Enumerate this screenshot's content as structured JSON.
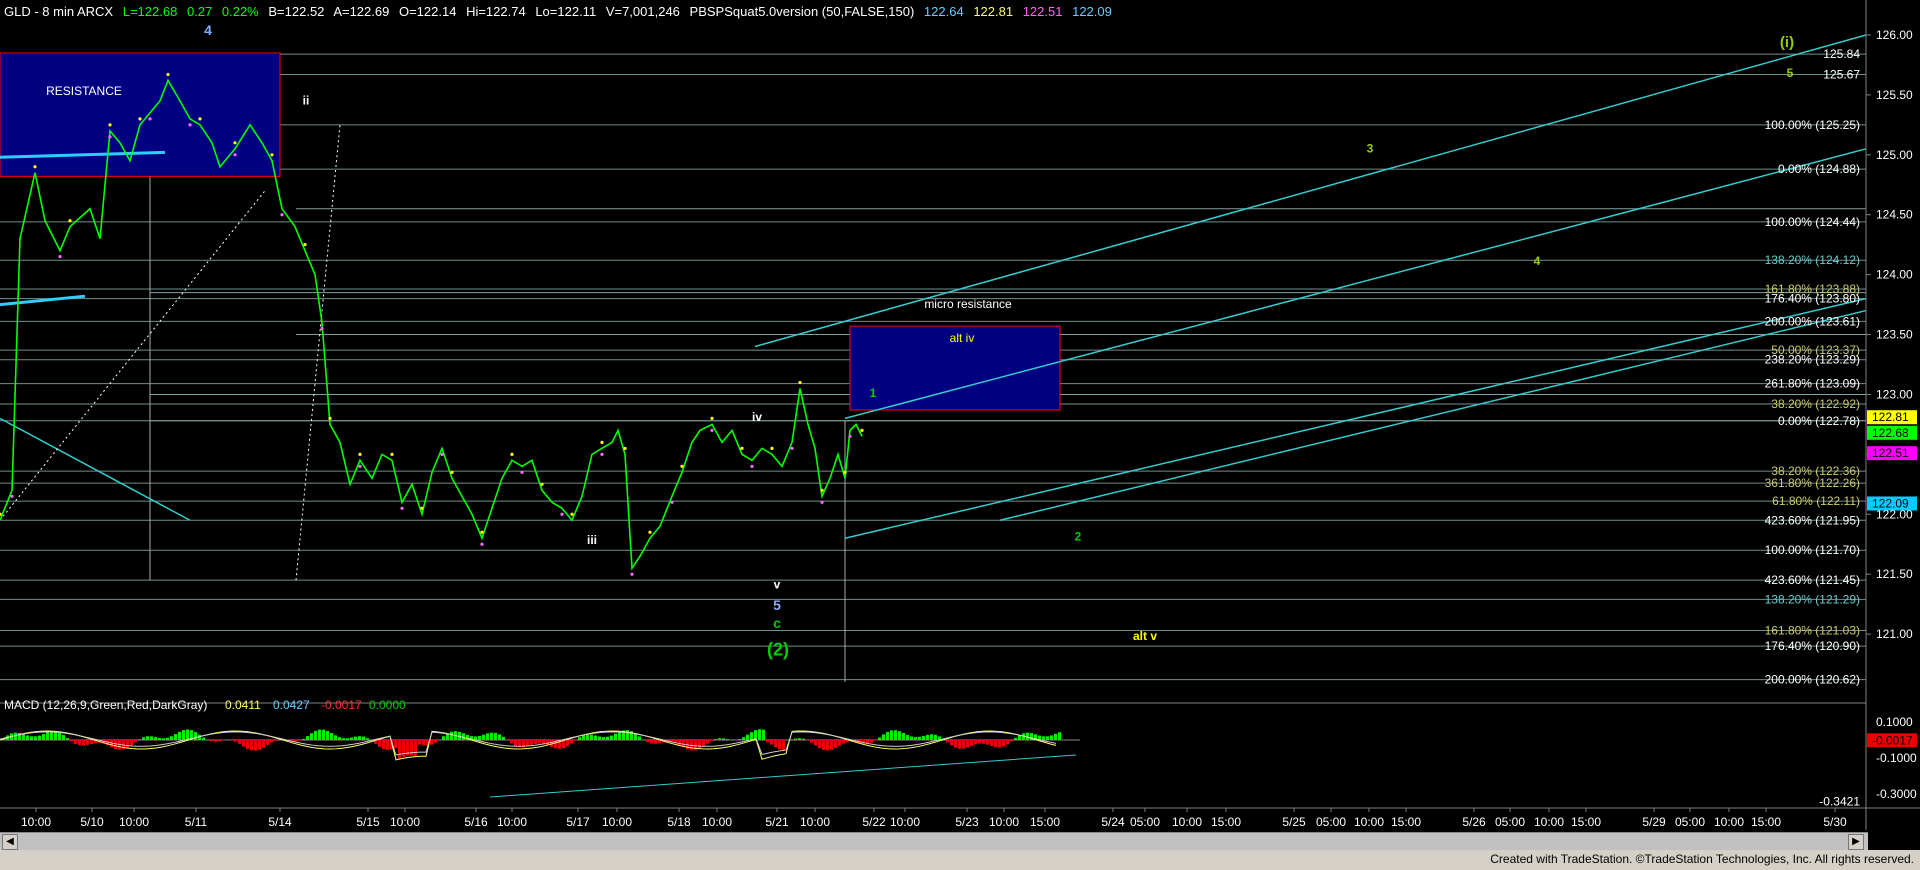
{
  "header": {
    "symbol": "GLD - 8 min  ARCX",
    "last": "L=122.68",
    "change": "0.27",
    "pct": "0.22%",
    "bid": "B=122.52",
    "ask": "A=122.69",
    "open": "O=122.14",
    "hi": "Hi=122.74",
    "lo": "Lo=122.11",
    "vol": "V=7,001,246",
    "study": "PBSPSquat5.0version (50,FALSE,150)",
    "study_values": [
      "122.64",
      "122.81",
      "122.51",
      "122.09"
    ],
    "colors": {
      "symbol": "#ffffff",
      "values": "#00ff00",
      "study": "#ffffff",
      "v1": "#66ccff",
      "v2": "#ffff66",
      "v3": "#ff66ff",
      "v4": "#66ccff"
    }
  },
  "price_axis": {
    "ticks": [
      "126.00",
      "125.50",
      "125.00",
      "124.50",
      "124.00",
      "123.50",
      "123.00",
      "122.50",
      "122.00",
      "121.50",
      "121.00"
    ],
    "ylim": [
      120.45,
      126.15
    ],
    "last_markers": [
      {
        "value": "122.81",
        "color": "#ffff00"
      },
      {
        "value": "122.68",
        "color": "#00ff00"
      },
      {
        "value": "122.51",
        "color": "#ff00ff"
      },
      {
        "value": "122.09",
        "color": "#00ccff"
      }
    ]
  },
  "chart_data": [
    {
      "type": "line",
      "title": "GLD - 8 min",
      "ylim": [
        120.45,
        126.15
      ],
      "x_ticks": [
        "10:00",
        "5/10",
        "10:00",
        "5/11",
        "5/14",
        "5/15",
        "10:00",
        "5/16",
        "10:00",
        "5/17",
        "10:00",
        "5/18",
        "10:00",
        "5/21",
        "10:00",
        "5/22",
        "10:00",
        "5/23",
        "10:00",
        "15:00",
        "5/24",
        "05:00",
        "10:00",
        "15:00",
        "5/25",
        "05:00",
        "10:00",
        "15:00",
        "5/26",
        "05:00",
        "10:00",
        "15:00",
        "5/29",
        "05:00",
        "10:00",
        "15:00",
        "5/30"
      ],
      "price_path": [
        [
          0,
          121.95
        ],
        [
          12,
          122.2
        ],
        [
          20,
          124.3
        ],
        [
          35,
          124.85
        ],
        [
          45,
          124.45
        ],
        [
          60,
          124.2
        ],
        [
          70,
          124.4
        ],
        [
          90,
          124.55
        ],
        [
          100,
          124.3
        ],
        [
          110,
          125.2
        ],
        [
          120,
          125.1
        ],
        [
          130,
          124.95
        ],
        [
          140,
          125.25
        ],
        [
          150,
          125.35
        ],
        [
          160,
          125.45
        ],
        [
          168,
          125.62
        ],
        [
          180,
          125.45
        ],
        [
          190,
          125.3
        ],
        [
          200,
          125.25
        ],
        [
          212,
          125.1
        ],
        [
          220,
          124.9
        ],
        [
          235,
          125.05
        ],
        [
          250,
          125.25
        ],
        [
          262,
          125.1
        ],
        [
          272,
          124.95
        ],
        [
          282,
          124.55
        ],
        [
          295,
          124.4
        ],
        [
          305,
          124.2
        ],
        [
          315,
          124.0
        ],
        [
          322,
          123.6
        ],
        [
          330,
          122.75
        ],
        [
          340,
          122.6
        ],
        [
          350,
          122.25
        ],
        [
          360,
          122.45
        ],
        [
          372,
          122.3
        ],
        [
          382,
          122.5
        ],
        [
          392,
          122.45
        ],
        [
          402,
          122.1
        ],
        [
          412,
          122.25
        ],
        [
          422,
          122.0
        ],
        [
          432,
          122.35
        ],
        [
          442,
          122.55
        ],
        [
          452,
          122.3
        ],
        [
          462,
          122.15
        ],
        [
          472,
          122.0
        ],
        [
          482,
          121.8
        ],
        [
          492,
          122.05
        ],
        [
          502,
          122.3
        ],
        [
          512,
          122.45
        ],
        [
          522,
          122.4
        ],
        [
          532,
          122.45
        ],
        [
          542,
          122.2
        ],
        [
          552,
          122.1
        ],
        [
          562,
          122.05
        ],
        [
          572,
          121.95
        ],
        [
          582,
          122.15
        ],
        [
          592,
          122.5
        ],
        [
          602,
          122.55
        ],
        [
          612,
          122.6
        ],
        [
          618,
          122.7
        ],
        [
          625,
          122.5
        ],
        [
          632,
          121.55
        ],
        [
          640,
          121.65
        ],
        [
          650,
          121.8
        ],
        [
          660,
          121.9
        ],
        [
          672,
          122.15
        ],
        [
          682,
          122.35
        ],
        [
          692,
          122.6
        ],
        [
          700,
          122.7
        ],
        [
          712,
          122.75
        ],
        [
          722,
          122.6
        ],
        [
          732,
          122.7
        ],
        [
          742,
          122.5
        ],
        [
          752,
          122.45
        ],
        [
          762,
          122.55
        ],
        [
          772,
          122.5
        ],
        [
          782,
          122.4
        ],
        [
          792,
          122.6
        ],
        [
          800,
          123.05
        ],
        [
          808,
          122.75
        ],
        [
          815,
          122.55
        ],
        [
          822,
          122.15
        ],
        [
          830,
          122.3
        ],
        [
          838,
          122.5
        ],
        [
          845,
          122.3
        ],
        [
          850,
          122.7
        ],
        [
          856,
          122.75
        ],
        [
          862,
          122.65
        ]
      ]
    },
    {
      "type": "line",
      "title": "MACD (12,26,9,Green,Red,DarkGray)",
      "values_label": [
        "0.0411",
        "0.0427",
        "-0.0017",
        "0.0000"
      ],
      "ticks": [
        "0.1000",
        "-0.1000",
        "-0.3000"
      ],
      "extra_labels": [
        "-0.3421"
      ],
      "last_marker": "-0.0017"
    }
  ],
  "fib_labels": [
    {
      "text": "125.84",
      "color": "#ffffff",
      "price": 125.84
    },
    {
      "text": "125.67",
      "color": "#ffffff",
      "price": 125.67
    },
    {
      "text": "100.00% (125.25)",
      "color": "#ffffff",
      "price": 125.25
    },
    {
      "text": "0.00% (124.88)",
      "color": "#ffffff",
      "price": 124.88
    },
    {
      "text": "100.00% (124.44)",
      "color": "#ffffff",
      "price": 124.44
    },
    {
      "text": "138.20% (124.12)",
      "color": "#66cccc",
      "price": 124.12
    },
    {
      "text": "161.80% (123.88)",
      "color": "#cccc66",
      "price": 123.88
    },
    {
      "text": "176.40% (123.80)",
      "color": "#ffffff",
      "price": 123.8
    },
    {
      "text": "200.00% (123.61)",
      "color": "#ffffff",
      "price": 123.61
    },
    {
      "text": "50.00% (123.37)",
      "color": "#cccc66",
      "price": 123.37
    },
    {
      "text": "238.20% (123.29)",
      "color": "#ffffff",
      "price": 123.29
    },
    {
      "text": "261.80% (123.09)",
      "color": "#ffffff",
      "price": 123.09
    },
    {
      "text": "38.20% (122.92)",
      "color": "#cccc66",
      "price": 122.92
    },
    {
      "text": "0.00% (122.78)",
      "color": "#ffffff",
      "price": 122.78
    },
    {
      "text": "38.20% (122.36)",
      "color": "#cccc66",
      "price": 122.36
    },
    {
      "text": "361.80% (122.26)",
      "color": "#cccc66",
      "price": 122.26
    },
    {
      "text": "61.80% (122.11)",
      "color": "#cccc66",
      "price": 122.11
    },
    {
      "text": "423.60% (121.95)",
      "color": "#ffffff",
      "price": 121.95
    },
    {
      "text": "100.00% (121.70)",
      "color": "#ffffff",
      "price": 121.7
    },
    {
      "text": "423.60% (121.45)",
      "color": "#ffffff",
      "price": 121.45
    },
    {
      "text": "138.20% (121.29)",
      "color": "#66cccc",
      "price": 121.29
    },
    {
      "text": "161.80% (121.03)",
      "color": "#cccc66",
      "price": 121.03
    },
    {
      "text": "176.40% (120.90)",
      "color": "#ffffff",
      "price": 120.9
    },
    {
      "text": "200.00% (120.62)",
      "color": "#ffffff",
      "price": 120.62
    }
  ],
  "wave_labels": [
    {
      "text": "4",
      "color": "#88aaff",
      "price": 126.0,
      "xpos": 208,
      "size": 14
    },
    {
      "text": "ii",
      "color": "#ffffff",
      "price": 125.42,
      "xpos": 306,
      "size": 12
    },
    {
      "text": "iv",
      "color": "#ffffff",
      "price": 122.78,
      "xpos": 757,
      "size": 12
    },
    {
      "text": "iii",
      "color": "#ffffff",
      "price": 121.75,
      "xpos": 592,
      "size": 12
    },
    {
      "text": "v",
      "color": "#ffffff",
      "price": 121.38,
      "xpos": 777,
      "size": 12
    },
    {
      "text": "5",
      "color": "#88aaff",
      "price": 121.2,
      "xpos": 777,
      "size": 14
    },
    {
      "text": "c",
      "color": "#00cc00",
      "price": 121.05,
      "xpos": 777,
      "size": 14
    },
    {
      "text": "(2)",
      "color": "#00cc00",
      "price": 120.82,
      "xpos": 778,
      "size": 18
    },
    {
      "text": "1",
      "color": "#00cc00",
      "price": 122.98,
      "xpos": 873,
      "size": 12
    },
    {
      "text": "2",
      "color": "#00cc00",
      "price": 121.78,
      "xpos": 1078,
      "size": 12
    },
    {
      "text": "3",
      "color": "#99cc00",
      "price": 125.02,
      "xpos": 1370,
      "size": 12
    },
    {
      "text": "4",
      "color": "#99cc00",
      "price": 124.08,
      "xpos": 1537,
      "size": 12
    },
    {
      "text": "5",
      "color": "#99cc00",
      "price": 125.65,
      "xpos": 1790,
      "size": 12
    },
    {
      "text": "(i)",
      "color": "#99cc00",
      "price": 125.9,
      "xpos": 1787,
      "size": 15
    },
    {
      "text": "alt v",
      "color": "#ffff00",
      "price": 120.95,
      "xpos": 1145,
      "size": 12
    }
  ],
  "boxes": {
    "resistance": {
      "label": "RESISTANCE",
      "color": "#000080",
      "border": "#ff0000",
      "top_price": 125.85,
      "bottom_price": 124.82
    },
    "alt_iv": {
      "label": "alt iv",
      "color": "#000080",
      "border": "#ff0000",
      "top_price": 123.57,
      "bottom_price": 122.87
    },
    "micro_resistance": {
      "label": "micro resistance"
    }
  },
  "footer": {
    "credit": "Created with TradeStation. ©TradeStation Technologies, Inc. All rights reserved."
  }
}
